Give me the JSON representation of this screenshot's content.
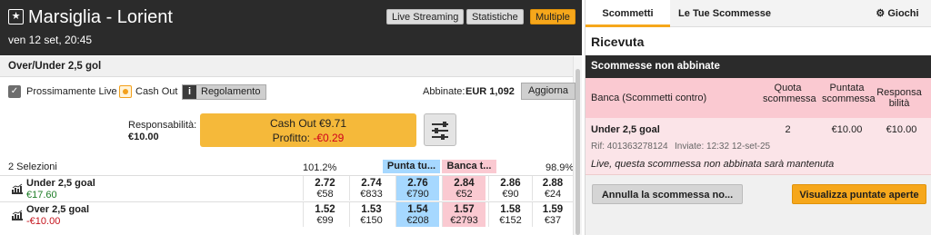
{
  "event": {
    "title": "Marsiglia - Lorient",
    "date": "ven 12 set, 20:45"
  },
  "header_buttons": {
    "live": "Live Streaming",
    "stats": "Statistiche",
    "multi": "Multiple"
  },
  "market": {
    "title": "Over/Under 2,5 gol"
  },
  "options": {
    "live_label": "Prossimamente Live",
    "cashout_label": "Cash Out",
    "rules": "Regolamento",
    "info": "i"
  },
  "matched": {
    "label": "Abbinate:",
    "amount": "EUR 1,092",
    "refresh": "Aggiorna"
  },
  "liability": {
    "label": "Responsabilità:",
    "value": "€10.00"
  },
  "cashout": {
    "title": "Cash Out €9.71",
    "profit_label": "Profitto:",
    "profit_value": "-€0.29"
  },
  "grid": {
    "selections": "2 Selezioni",
    "back_pct": "101.2%",
    "lay_pct": "98.9%",
    "back_header": "Punta tu...",
    "lay_header": "Banca t...",
    "rows": [
      {
        "name": "Under 2,5 goal",
        "pl": "€17.60",
        "pl_color": "#1e7d27",
        "cells": [
          [
            "2.72",
            "€58"
          ],
          [
            "2.74",
            "€833"
          ],
          [
            "2.76",
            "€790"
          ],
          [
            "2.84",
            "€52"
          ],
          [
            "2.86",
            "€90"
          ],
          [
            "2.88",
            "€24"
          ]
        ]
      },
      {
        "name": "Over 2,5 goal",
        "pl": "-€10.00",
        "pl_color": "#c4121b",
        "cells": [
          [
            "1.52",
            "€99"
          ],
          [
            "1.53",
            "€150"
          ],
          [
            "1.54",
            "€208"
          ],
          [
            "1.57",
            "€2793"
          ],
          [
            "1.58",
            "€152"
          ],
          [
            "1.59",
            "€37"
          ]
        ]
      }
    ]
  },
  "colors": {
    "back": "#a6d8ff",
    "lay": "#fac9d1",
    "cashout": "#f5b93a",
    "header": "#2b2b2b",
    "accent": "#f6a71b"
  },
  "betslip": {
    "tabs": {
      "bets": "Scommetti",
      "my_bets": "Le Tue Scommesse",
      "games": "Giochi"
    },
    "received": "Ricevuta",
    "unmatched_title": "Scommesse non abbinate",
    "table": {
      "col_bet": "Banca (Scommetti contro)",
      "col_odds": "Quota scommessa",
      "col_stake": "Puntata scommessa",
      "col_liab": "Responsabilità"
    },
    "bet": {
      "name": "Under 2,5 goal",
      "odds": "2",
      "stake": "€10.00",
      "liability": "€10.00",
      "ref": "Rif: 401363278124",
      "placed": "Inviate: 12:32 12-set-25"
    },
    "note": "Live, questa scommessa non abbinata sarà mantenuta",
    "cancel": "Annulla la scommessa no...",
    "view_open": "Visualizza puntate aperte"
  }
}
